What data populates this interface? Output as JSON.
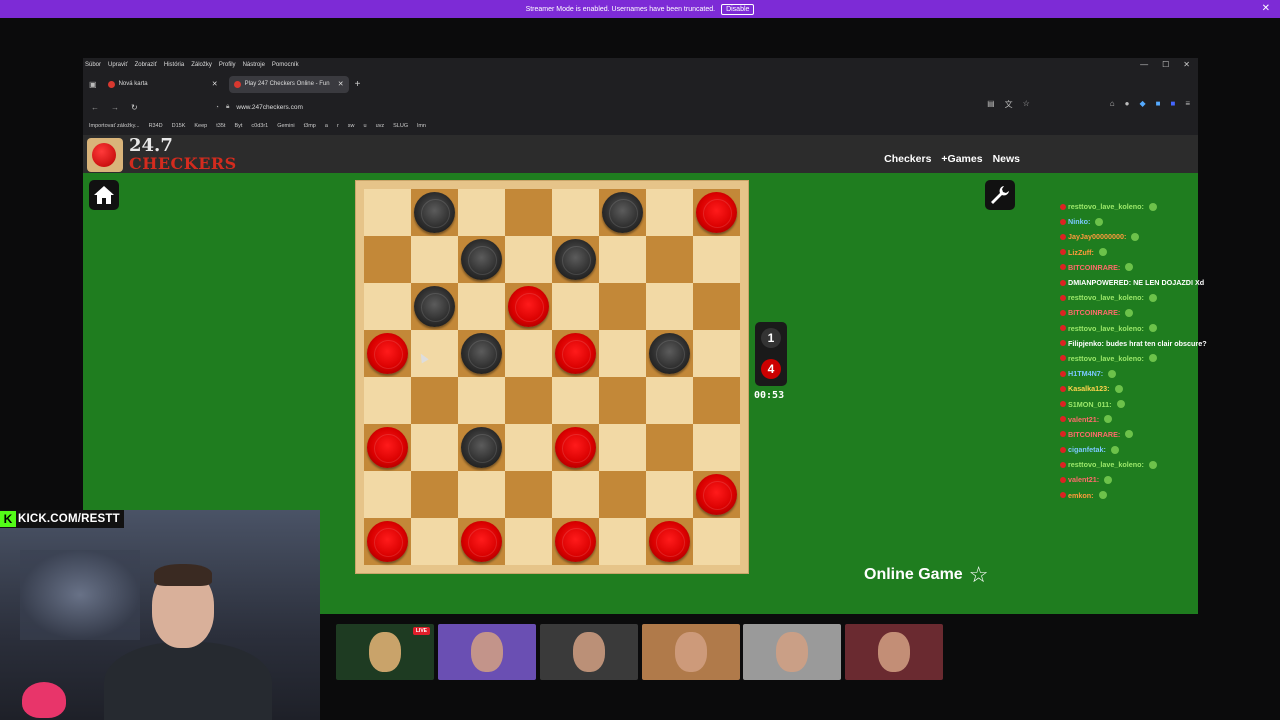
{
  "banner": {
    "text": "Streamer Mode is enabled. Usernames have been truncated.",
    "disable_label": "Disable"
  },
  "menu": [
    "Súbor",
    "Upraviť",
    "Zobraziť",
    "História",
    "Záložky",
    "Profily",
    "Nástroje",
    "Pomocník"
  ],
  "tabs": [
    {
      "label": "Nová karta"
    },
    {
      "label": "Play 247 Checkers Online - Fun"
    }
  ],
  "url": "www.247checkers.com",
  "bookmarks": [
    "Importovať záložky...",
    "R34D",
    "D15K",
    "Keep",
    "t35t",
    "Byt",
    "c0d3r1",
    "Gemini",
    "t3mp",
    "a",
    "r",
    "sw",
    "u",
    "uvz",
    "SLUG",
    "lmn"
  ],
  "site": {
    "logo_number": "24.7",
    "logo_text": "CHECKERS",
    "nav": [
      "Checkers",
      "+Games",
      "News"
    ]
  },
  "board": {
    "rows": [
      [
        "",
        "black",
        "",
        "",
        "",
        "black",
        "",
        "red"
      ],
      [
        "",
        "",
        "black",
        "",
        "black",
        "",
        "",
        ""
      ],
      [
        "",
        "black",
        "",
        "red",
        "",
        "",
        "",
        ""
      ],
      [
        "red",
        "",
        "black",
        "",
        "red",
        "",
        "black",
        ""
      ],
      [
        "",
        "",
        "",
        "",
        "",
        "",
        "",
        ""
      ],
      [
        "red",
        "",
        "black",
        "",
        "red",
        "",
        "",
        ""
      ],
      [
        "",
        "",
        "",
        "",
        "",
        "",
        "",
        "red"
      ],
      [
        "red",
        "",
        "red",
        "",
        "red",
        "",
        "red",
        ""
      ]
    ]
  },
  "score": {
    "black": "1",
    "red": "4"
  },
  "timer": "00:53",
  "game_mode": "Online Game",
  "chat": [
    {
      "user": "resttovo_lave_koleno:",
      "text": "",
      "color": "#9be86a"
    },
    {
      "user": "Ninko:",
      "text": "",
      "color": "#7bc8ff"
    },
    {
      "user": "JayJay00000000:",
      "text": "",
      "color": "#ff9a3c"
    },
    {
      "user": "LizZuff:",
      "text": "",
      "color": "#ff9a3c"
    },
    {
      "user": "BITCOINRARE:",
      "text": "",
      "color": "#ff6b6b"
    },
    {
      "user": "DMIANPOWERED:",
      "text": "NE LEN DOJAZDI Xd",
      "color": "#ffffff"
    },
    {
      "user": "resttovo_lave_koleno:",
      "text": "",
      "color": "#9be86a"
    },
    {
      "user": "BITCOINRARE:",
      "text": "",
      "color": "#ff6b6b"
    },
    {
      "user": "resttovo_lave_koleno:",
      "text": "",
      "color": "#9be86a"
    },
    {
      "user": "Filipjenko:",
      "text": "budes hrat ten clair obscure?",
      "color": "#ffffff"
    },
    {
      "user": "resttovo_lave_koleno:",
      "text": "",
      "color": "#9be86a"
    },
    {
      "user": "H1TM4N7:",
      "text": "",
      "color": "#7bc8ff"
    },
    {
      "user": "Kasalka123:",
      "text": "",
      "color": "#ffd34d"
    },
    {
      "user": "S1MON_011:",
      "text": "",
      "color": "#9be86a"
    },
    {
      "user": "valent21:",
      "text": "",
      "color": "#ff6b6b"
    },
    {
      "user": "BITCOINRARE:",
      "text": "",
      "color": "#ff6b6b"
    },
    {
      "user": "ciganfetak:",
      "text": "",
      "color": "#7bc8ff"
    },
    {
      "user": "resttovo_lave_koleno:",
      "text": "",
      "color": "#9be86a"
    },
    {
      "user": "valent21:",
      "text": "",
      "color": "#ff6b6b"
    },
    {
      "user": "emkon:",
      "text": "",
      "color": "#ff9a3c"
    }
  ],
  "stream": {
    "kick_label": "KICK.COM/RESTT",
    "live_label": "LIVE"
  },
  "thumbnails": [
    {
      "bg": "#1e3b22"
    },
    {
      "bg": "#6a4fb3"
    },
    {
      "bg": "#3a3a3a"
    },
    {
      "bg": "#b07a4a"
    },
    {
      "bg": "#9a9a9a"
    },
    {
      "bg": "#6a2a30"
    }
  ]
}
